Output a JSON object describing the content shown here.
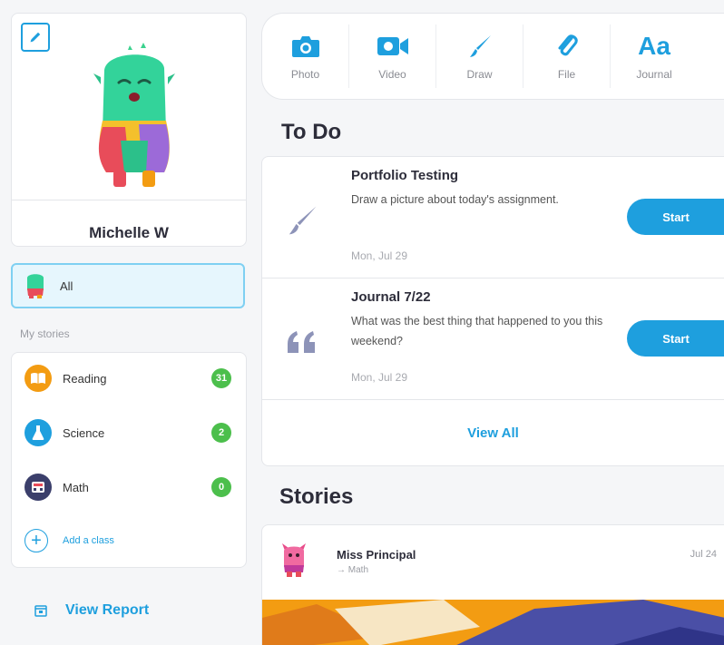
{
  "profile": {
    "name": "Michelle W"
  },
  "stories_filter": {
    "all_label": "All",
    "section_label": "My stories",
    "classes": [
      {
        "name": "Reading",
        "count": "31",
        "color": "#f39c12"
      },
      {
        "name": "Science",
        "count": "2",
        "color": "#1e9fde"
      },
      {
        "name": "Math",
        "count": "0",
        "color": "#3b3f6b"
      }
    ],
    "add_class_label": "Add a class"
  },
  "view_report_label": "View Report",
  "toolbar": {
    "tools": [
      {
        "label": "Photo",
        "icon": "camera-icon"
      },
      {
        "label": "Video",
        "icon": "video-camera-icon"
      },
      {
        "label": "Draw",
        "icon": "paintbrush-icon"
      },
      {
        "label": "File",
        "icon": "paperclip-icon"
      },
      {
        "label": "Journal",
        "icon": "text-aa-icon",
        "glyph": "Aa"
      }
    ]
  },
  "todo": {
    "title": "To Do",
    "items": [
      {
        "title": "Portfolio Testing",
        "description": "Draw a picture about today's assignment.",
        "date": "Mon, Jul 29",
        "button": "Start",
        "icon": "paintbrush-icon"
      },
      {
        "title": "Journal 7/22",
        "description": "What was the best thing that happened to you this weekend?",
        "date": "Mon, Jul 29",
        "button": "Start",
        "icon": "quote-icon"
      }
    ],
    "view_all_label": "View All"
  },
  "stories": {
    "title": "Stories",
    "posts": [
      {
        "author": "Miss Principal",
        "class": "Math",
        "date": "Jul 24"
      }
    ]
  },
  "colors": {
    "accent": "#1e9fde",
    "count_badge": "#4cbf4c",
    "selected_bg": "#e6f6fd",
    "icon_muted": "#8d93b8"
  }
}
